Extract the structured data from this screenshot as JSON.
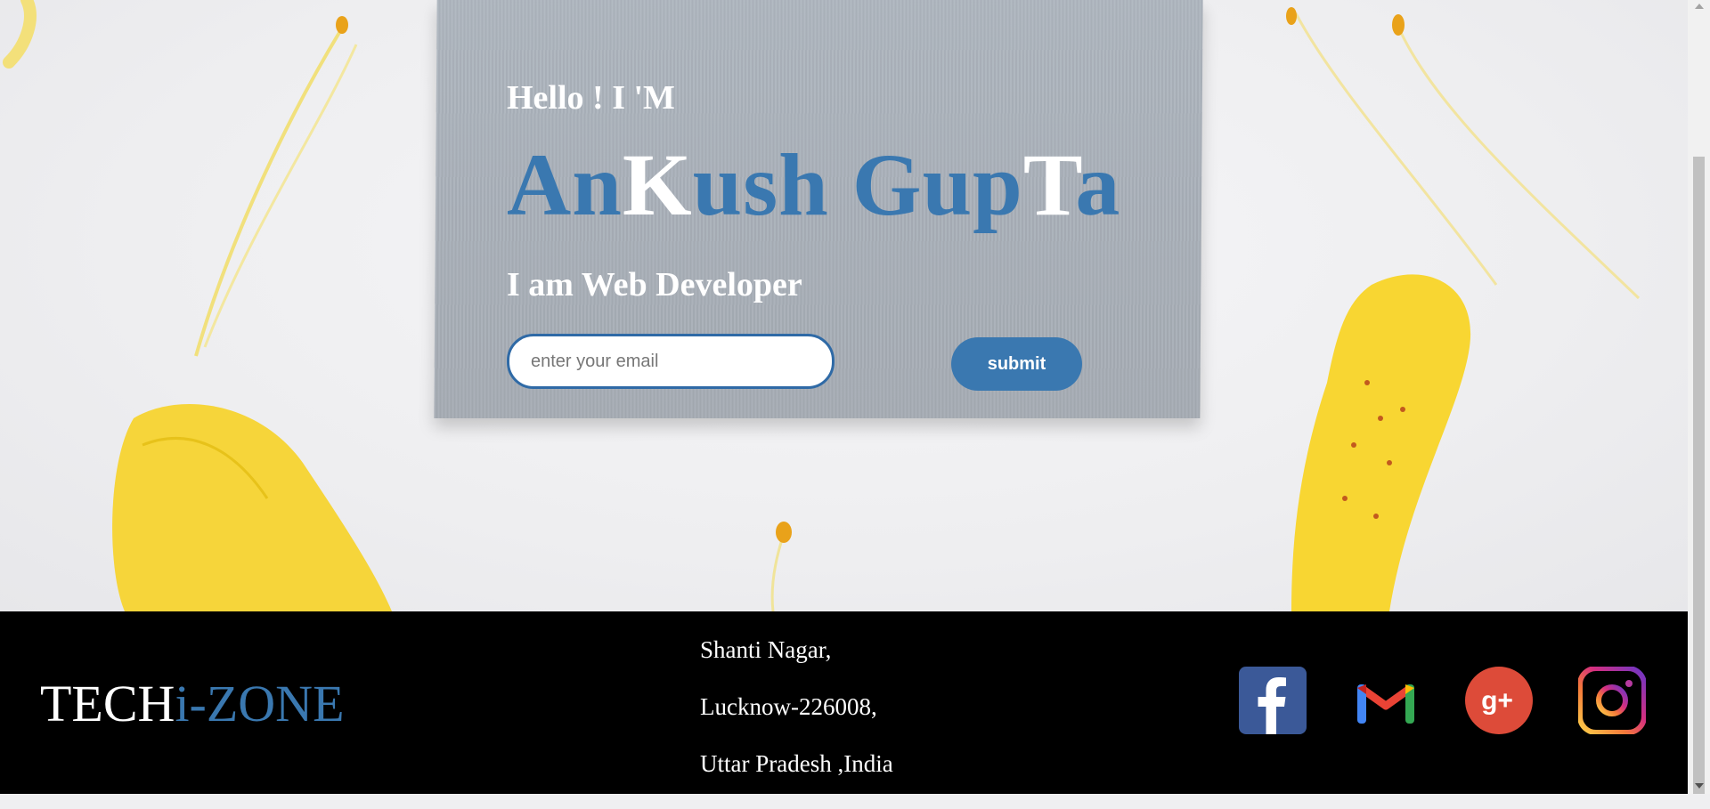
{
  "hero": {
    "greeting": "Hello ! I 'M",
    "name_parts": [
      "An",
      "K",
      "ush Gup",
      "T",
      "a"
    ],
    "role": "I am Web Developer",
    "email_placeholder": "enter your email",
    "submit_label": "submit"
  },
  "footer": {
    "brand_primary": "TECH",
    "brand_accent": "i-ZONE",
    "address_lines": [
      "Shanti Nagar,",
      "Lucknow-226008,",
      "Uttar Pradesh ,India"
    ],
    "socials": [
      "facebook-icon",
      "gmail-icon",
      "google-plus-icon",
      "instagram-icon"
    ]
  },
  "colors": {
    "accent": "#3a78b0",
    "footer_bg": "#000000",
    "card_bg": "#aab1ba"
  }
}
